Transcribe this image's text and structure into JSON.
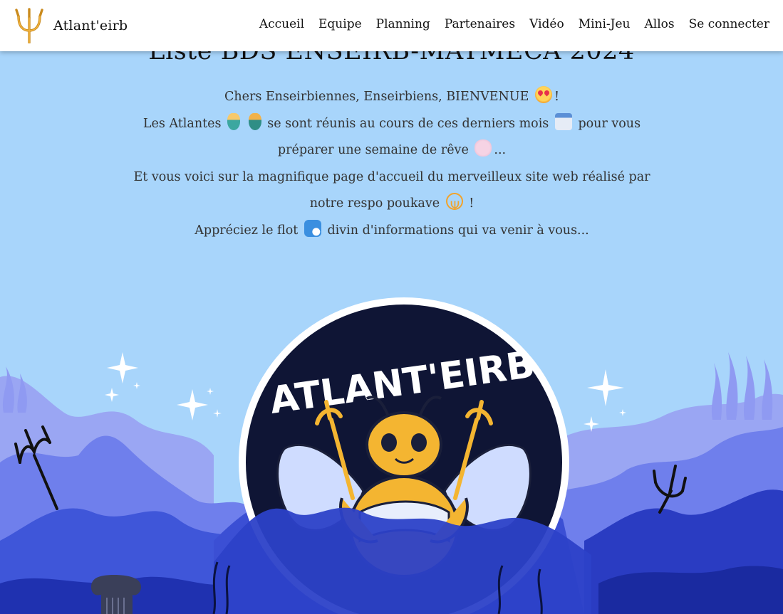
{
  "brand": {
    "name": "Atlant'eirb",
    "logo_icon": "trident-icon"
  },
  "nav": {
    "links": [
      {
        "label": "Accueil"
      },
      {
        "label": "Equipe"
      },
      {
        "label": "Planning"
      },
      {
        "label": "Partenaires"
      },
      {
        "label": "Vidéo"
      },
      {
        "label": "Mini-Jeu"
      },
      {
        "label": "Allos"
      },
      {
        "label": "Se connecter"
      }
    ]
  },
  "hero": {
    "title": "Liste BDS ENSEIRB-MATMECA 2024",
    "intro": {
      "l1a": "Chers Enseirbiennes, Enseirbiens, BIENVENUE",
      "l1b": "!",
      "l2a": "Les Atlantes",
      "l2b": "se sont réunis au cours de ces derniers mois",
      "l2c": "pour vous préparer une semaine de rêve",
      "l2d": "...",
      "l3a": "Et vous voici sur la magnifique page d'accueil du merveilleux site web réalisé par notre respo poukave",
      "l3b": "!",
      "l4a": "Appréciez le flot",
      "l4b": "divin d'informations qui va venir à vous..."
    },
    "emojis": [
      "heart-eyes-icon",
      "merperson-icon",
      "mermaid-icon",
      "calendar-icon",
      "brain-icon",
      "trident-icon",
      "wave-icon"
    ],
    "badge_text": "ATLANT'EIRB"
  },
  "colors": {
    "sky": "#a8d5fb",
    "hill_far": "#8f9af2",
    "hill_mid": "#5a6ee6",
    "hill_near": "#2f44c9",
    "badge_bg": "#0f1535",
    "bee_yellow": "#f4b531"
  }
}
